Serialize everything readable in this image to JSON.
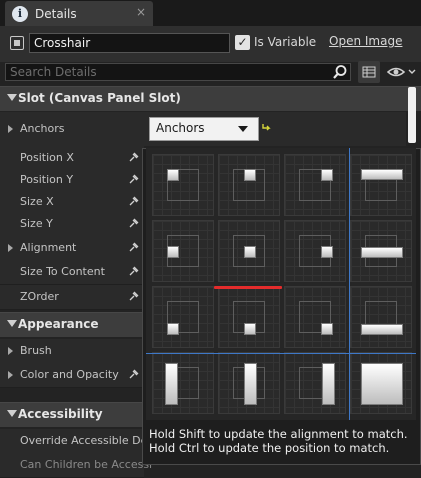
{
  "tab": {
    "title": "Details",
    "icon": "info-icon",
    "close": "×"
  },
  "header": {
    "name_value": "Crosshair",
    "is_variable_label": "Is Variable",
    "is_variable_checked": true,
    "open_image_label": "Open Image"
  },
  "search": {
    "placeholder": "Search Details"
  },
  "sections": {
    "slot": "Slot (Canvas Panel Slot)",
    "appearance": "Appearance",
    "accessibility": "Accessibility"
  },
  "slot_props": {
    "anchors": "Anchors",
    "position_x": "Position X",
    "position_y": "Position Y",
    "size_x": "Size X",
    "size_y": "Size Y",
    "alignment": "Alignment",
    "size_to_content": "Size To Content",
    "zorder": "ZOrder"
  },
  "appearance_props": {
    "brush": "Brush",
    "color_and_opacity": "Color and Opacity"
  },
  "accessibility_props": {
    "override": "Override Accessible Def",
    "can_children": "Can Children be Accessi"
  },
  "anchors_combo": {
    "value": "Anchors"
  },
  "popup": {
    "hint_line1": "Hold Shift to update the alignment to match.",
    "hint_line2": "Hold Ctrl to update the position to match.",
    "presets": [
      "top-left",
      "top-center",
      "top-right",
      "top-stretch",
      "center-left",
      "center-center",
      "center-right",
      "center-stretch",
      "bottom-left",
      "bottom-center",
      "bottom-right",
      "bottom-stretch",
      "left-stretch-vertical",
      "center-stretch-vertical",
      "right-stretch-vertical",
      "full-stretch"
    ]
  },
  "colors": {
    "accent_blue": "#3e78c8",
    "highlight_red": "#e42c2c",
    "panel_bg": "#232323"
  }
}
